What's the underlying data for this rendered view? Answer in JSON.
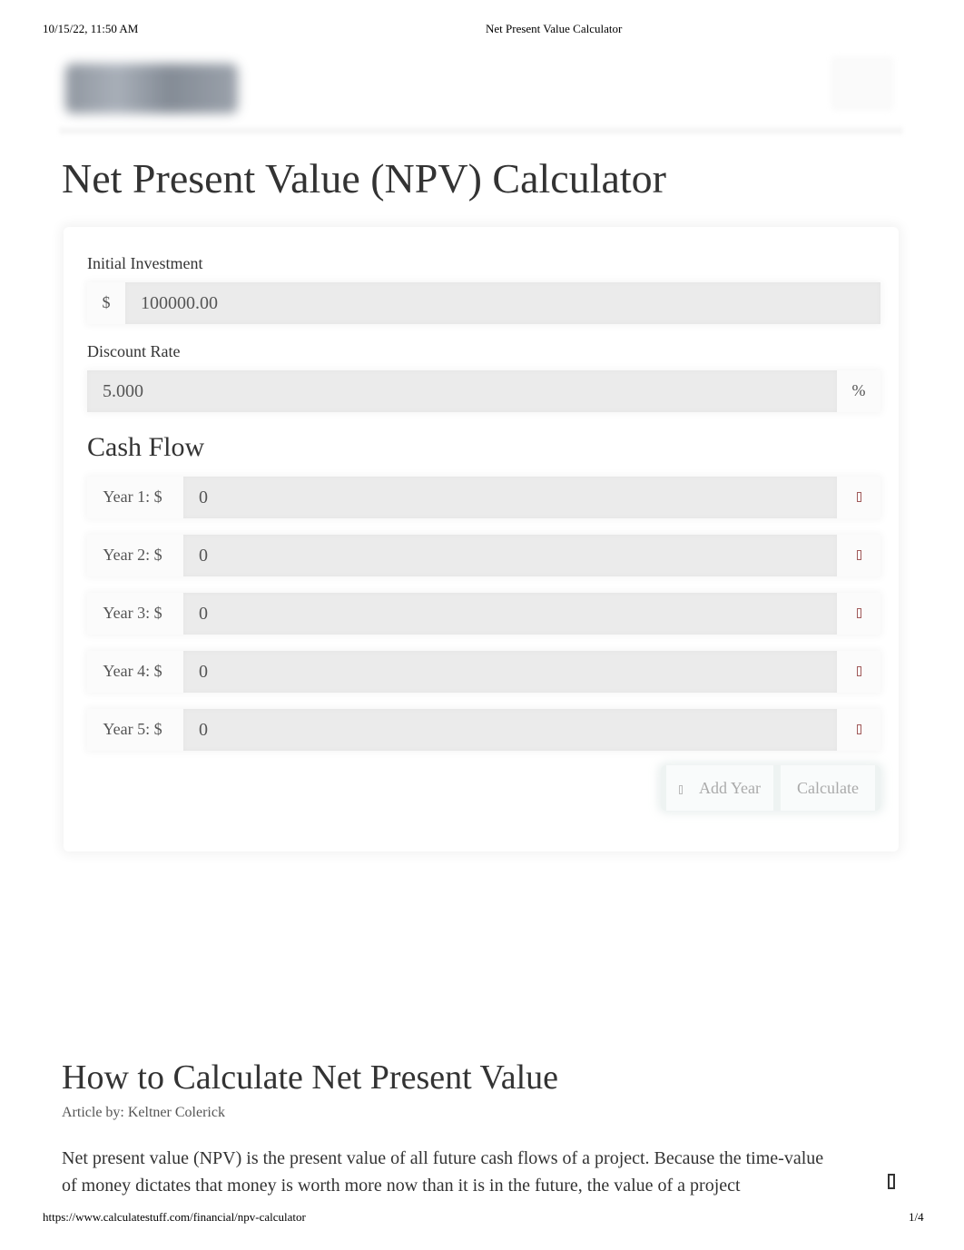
{
  "print_header": {
    "datetime": "10/15/22, 11:50 AM",
    "title": "Net Present Value Calculator"
  },
  "print_footer": {
    "url": "https://www.calculatestuff.com/financial/npv-calculator",
    "page": "1/4"
  },
  "header": {
    "logo": "site-logo",
    "menu_icon": "menu-icon"
  },
  "page_title": "Net Present Value (NPV) Calculator",
  "calculator": {
    "initial_investment": {
      "label": "Initial Investment",
      "prefix": "$",
      "value": "100000.00"
    },
    "discount_rate": {
      "label": "Discount Rate",
      "value": "5.000",
      "suffix": "%"
    },
    "cash_flow_title": "Cash Flow",
    "cash_flows": [
      {
        "label": "Year 1: $",
        "value": "0",
        "remove_icon": "trash-icon"
      },
      {
        "label": "Year 2: $",
        "value": "0",
        "remove_icon": "trash-icon"
      },
      {
        "label": "Year 3: $",
        "value": "0",
        "remove_icon": "trash-icon"
      },
      {
        "label": "Year 4: $",
        "value": "0",
        "remove_icon": "trash-icon"
      },
      {
        "label": "Year 5: $",
        "value": "0",
        "remove_icon": "trash-icon"
      }
    ],
    "add_year_label": "Add Year",
    "calculate_label": "Calculate"
  },
  "article": {
    "title": "How to Calculate Net Present Value",
    "byline": "Article by: Keltner Colerick",
    "paragraph": "Net present value (NPV) is the present value of all future cash flows of a project. Because the time-value of money dictates that money is worth more now than it is in the future, the value of a project"
  },
  "colors": {
    "input_bg": "#ebebeb",
    "trash": "#a05a5a",
    "button_text": "#aaaaaa"
  }
}
